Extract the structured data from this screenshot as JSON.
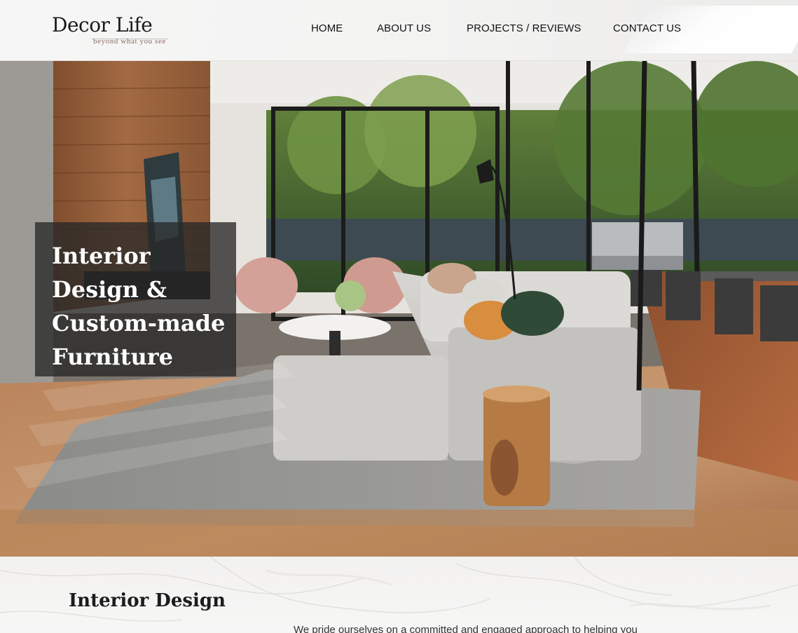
{
  "brand": {
    "name": "Decor Life",
    "tagline": "beyond what you see"
  },
  "nav": {
    "items": [
      {
        "label": "HOME"
      },
      {
        "label": "ABOUT US"
      },
      {
        "label": "PROJECTS / REVIEWS"
      },
      {
        "label": "CONTACT US"
      }
    ]
  },
  "hero": {
    "title_lines": [
      "Interior",
      "Design &",
      "Custom-made",
      "Furniture"
    ]
  },
  "intro": {
    "heading": "Interior Design",
    "text": "We pride ourselves on a committed and engaged approach to helping you"
  }
}
